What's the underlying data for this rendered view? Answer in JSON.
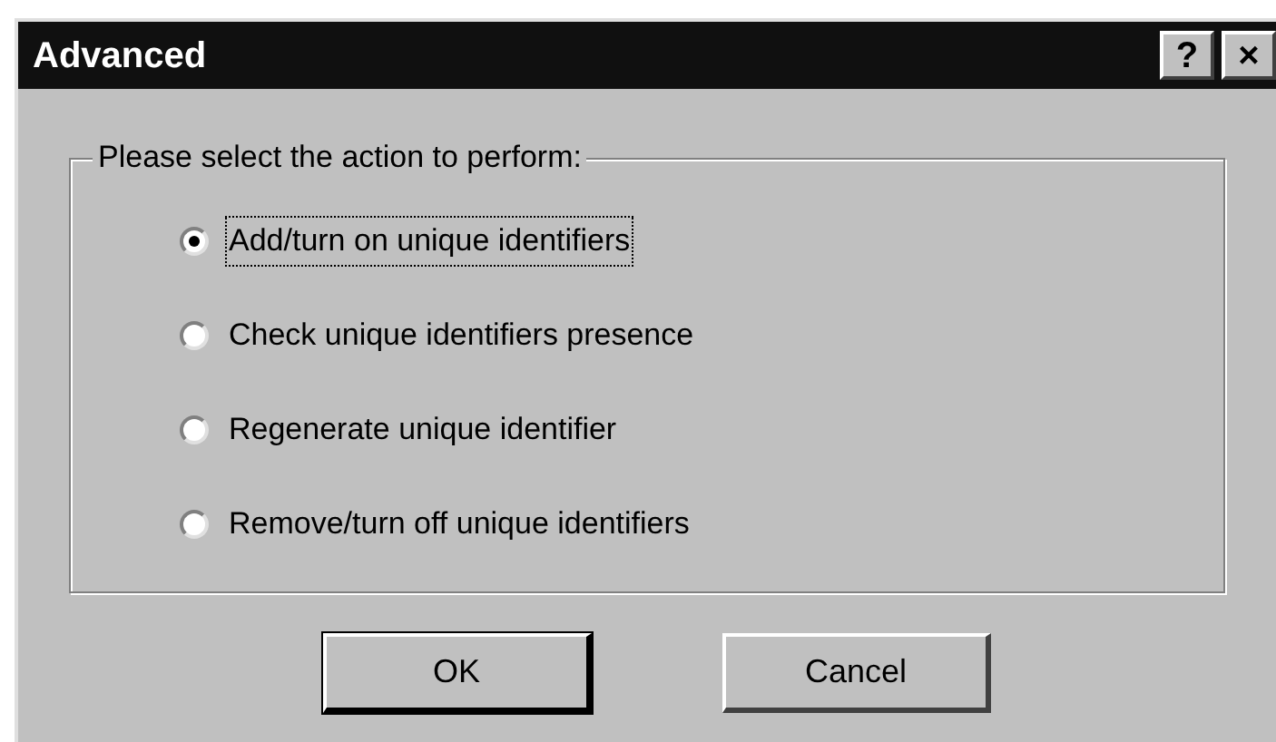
{
  "window": {
    "title": "Advanced",
    "title_buttons": [
      "?",
      "×"
    ]
  },
  "group": {
    "label": "Please select the action to perform:",
    "options": [
      {
        "label": "Add/turn on unique identifiers",
        "selected": true
      },
      {
        "label": "Check unique identifiers presence",
        "selected": false
      },
      {
        "label": "Regenerate unique identifier",
        "selected": false
      },
      {
        "label": "Remove/turn off unique identifiers",
        "selected": false
      }
    ]
  },
  "buttons": [
    {
      "label": "OK",
      "default": true
    },
    {
      "label": "Cancel",
      "default": false
    }
  ]
}
